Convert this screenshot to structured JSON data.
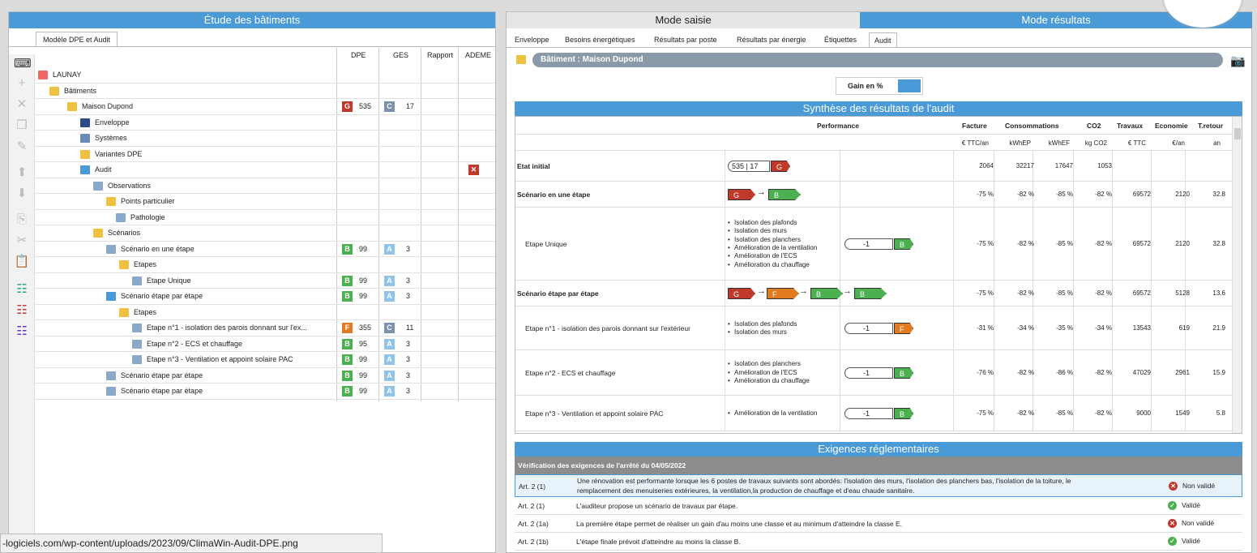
{
  "left": {
    "title": "Étude des bâtiments",
    "tab": "Modèle DPE et Audit",
    "columns": [
      "DPE",
      "GES",
      "Rapport",
      "ADEME"
    ],
    "tree": [
      {
        "label": "LAUNAY"
      },
      {
        "label": "Bâtiments"
      },
      {
        "label": "Maison Dupond",
        "dpe": "G",
        "dpe_val": "535",
        "ges": "C",
        "ges_val": "17"
      },
      {
        "label": "Enveloppe"
      },
      {
        "label": "Systèmes"
      },
      {
        "label": "Variantes DPE"
      },
      {
        "label": "Audit"
      },
      {
        "label": "Observations"
      },
      {
        "label": "Points particulier"
      },
      {
        "label": "Pathologie"
      },
      {
        "label": "Scénarios"
      },
      {
        "label": "Scénario en une étape",
        "dpe": "B",
        "dpe_val": "99",
        "ges": "A",
        "ges_val": "3"
      },
      {
        "label": "Etapes"
      },
      {
        "label": "Etape Unique",
        "dpe": "B",
        "dpe_val": "99",
        "ges": "A",
        "ges_val": "3"
      },
      {
        "label": "Scénario étape par étape",
        "dpe": "B",
        "dpe_val": "99",
        "ges": "A",
        "ges_val": "3"
      },
      {
        "label": "Etapes"
      },
      {
        "label": "Etape n°1 - isolation des parois donnant sur l'ex...",
        "dpe": "F",
        "dpe_val": "355",
        "ges": "C",
        "ges_val": "11"
      },
      {
        "label": "Etape n°2 - ECS et chauffage",
        "dpe": "B",
        "dpe_val": "95",
        "ges": "A",
        "ges_val": "3"
      },
      {
        "label": "Etape n°3 - Ventilation et appoint solaire PAC",
        "dpe": "B",
        "dpe_val": "99",
        "ges": "A",
        "ges_val": "3"
      },
      {
        "label": "Scénario étape par étape",
        "dpe": "B",
        "dpe_val": "99",
        "ges": "A",
        "ges_val": "3"
      },
      {
        "label": "Scénario étape par étape",
        "dpe": "B",
        "dpe_val": "99",
        "ges": "A",
        "ges_val": "3"
      }
    ]
  },
  "right": {
    "mode_saisie": "Mode saisie",
    "mode_resultats": "Mode résultats",
    "tabs": [
      "Enveloppe",
      "Besoins énergétiques",
      "Résultats par poste",
      "Résultats par énergie",
      "Étiquettes",
      "Audit"
    ],
    "batiment": "Bâtiment : Maison Dupond",
    "gain": "Gain en %",
    "synthese_title": "Synthèse des résultats de l'audit",
    "headers": {
      "performance": "Performance",
      "facture": "Facture",
      "consommations": "Consommations",
      "co2": "CO2",
      "travaux": "Travaux",
      "economie": "Economie",
      "retour": "T.retour"
    },
    "units": [
      "€ TTC/an",
      "kWhEP",
      "kWhEF",
      "kg CO2",
      "€ TTC",
      "€/an",
      "an"
    ],
    "rows": [
      {
        "label": "Etat initial",
        "bold": true,
        "bullets": [],
        "facture": "2064",
        "kwhep": "32217",
        "kwhef": "17647",
        "co2": "1053",
        "travaux": "",
        "eco": "",
        "ret": ""
      },
      {
        "label": "Scénario en une étape",
        "bold": true,
        "bullets": [],
        "facture": "-75 %",
        "kwhep": "-82 %",
        "kwhef": "-85 %",
        "co2": "-82 %",
        "travaux": "69572",
        "eco": "2120",
        "ret": "32.8"
      },
      {
        "label": "Etape Unique",
        "bold": false,
        "bullets": [
          "Isolation des plafonds",
          "Isolation des murs",
          "Isolation des planchers",
          "Amélioration de la ventilation",
          "Amélioration de l'ECS",
          "Amélioration du chauffage"
        ],
        "facture": "-75 %",
        "kwhep": "-82 %",
        "kwhef": "-85 %",
        "co2": "-82 %",
        "travaux": "69572",
        "eco": "2120",
        "ret": "32.8"
      },
      {
        "label": "Scénario étape par étape",
        "bold": true,
        "bullets": [],
        "facture": "-75 %",
        "kwhep": "-82 %",
        "kwhef": "-85 %",
        "co2": "-82 %",
        "travaux": "69572",
        "eco": "5128",
        "ret": "13.6"
      },
      {
        "label": "Etape n°1 - isolation des parois donnant sur l'extérieur",
        "bold": false,
        "bullets": [
          "Isolation des plafonds",
          "Isolation des murs"
        ],
        "facture": "-31 %",
        "kwhep": "-34 %",
        "kwhef": "-35 %",
        "co2": "-34 %",
        "travaux": "13543",
        "eco": "619",
        "ret": "21.9"
      },
      {
        "label": "Etape n°2 - ECS et chauffage",
        "bold": false,
        "bullets": [
          "Isolation des planchers",
          "Amélioration de l'ECS",
          "Amélioration du chauffage"
        ],
        "facture": "-76 %",
        "kwhep": "-82 %",
        "kwhef": "-86 %",
        "co2": "-82 %",
        "travaux": "47029",
        "eco": "2961",
        "ret": "15.9"
      },
      {
        "label": "Etape n°3 - Ventilation et appoint solaire PAC",
        "bold": false,
        "bullets": [
          "Amélioration de la ventilation"
        ],
        "facture": "-75 %",
        "kwhep": "-82 %",
        "kwhef": "-85 %",
        "co2": "-82 %",
        "travaux": "9000",
        "eco": "1549",
        "ret": "5.8"
      }
    ],
    "etat_label": "535 | 17",
    "scale_label": "-1",
    "exigences_title": "Exigences réglementaires",
    "exigences_sub": "Vérification des exigences de l'arrêté du 04/05/2022",
    "exigences": [
      {
        "art": "Art. 2 (1)",
        "text1": "Une rénovation est performante lorsque les 6 postes de travaux suivants sont abordés: l'isolation des murs, l'isolation des planchers bas, l'isolation de la toiture, le",
        "text2": "remplacement des menuiseries extérieures, la ventilation,la production de chauffage et d'eau chaude sanitaire.",
        "status": "Non validé"
      },
      {
        "art": "Art. 2 (1)",
        "text1": "L'auditeur propose un scénario de travaux par étape.",
        "text2": "",
        "status": "Validé"
      },
      {
        "art": "Art. 2 (1a)",
        "text1": "La première étape permet de réaliser un gain d'au moins une classe et au minimum d'atteindre la classe E.",
        "text2": "",
        "status": "Non validé"
      },
      {
        "art": "Art. 2 (1b)",
        "text1": "L'étape finale prévoit d'atteindre au moins la classe B.",
        "text2": "",
        "status": "Validé"
      }
    ]
  },
  "statusbar": {
    "url": "-logiciels.com/wp-content/uploads/2023/09/ClimaWin-Audit-DPE.png"
  },
  "colors": {
    "accent": "#4a9ad8",
    "G": "#c0392b",
    "F": "#e07b22",
    "C": "#7e8fb0",
    "B": "#4caf50",
    "A": "#8fc3ea"
  }
}
